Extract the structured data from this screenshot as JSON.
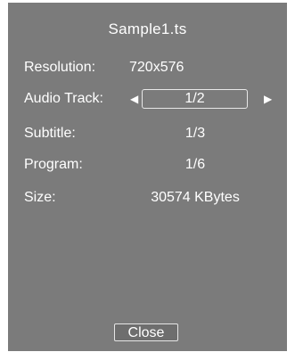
{
  "dialog": {
    "title": "Sample1.ts",
    "resolution": {
      "label": "Resolution:",
      "value": "720x576"
    },
    "audio_track": {
      "label": "Audio Track:",
      "value": "1/2",
      "left_arrow": "◀",
      "right_arrow": "▶"
    },
    "subtitle": {
      "label": "Subtitle:",
      "value": "1/3"
    },
    "program": {
      "label": "Program:",
      "value": "1/6"
    },
    "size": {
      "label": "Size:",
      "value": "30574 KBytes"
    },
    "close_label": "Close"
  },
  "colors": {
    "panel_bg": "#7b7b7b",
    "text": "#ffffff",
    "border": "#e8e8e8"
  }
}
